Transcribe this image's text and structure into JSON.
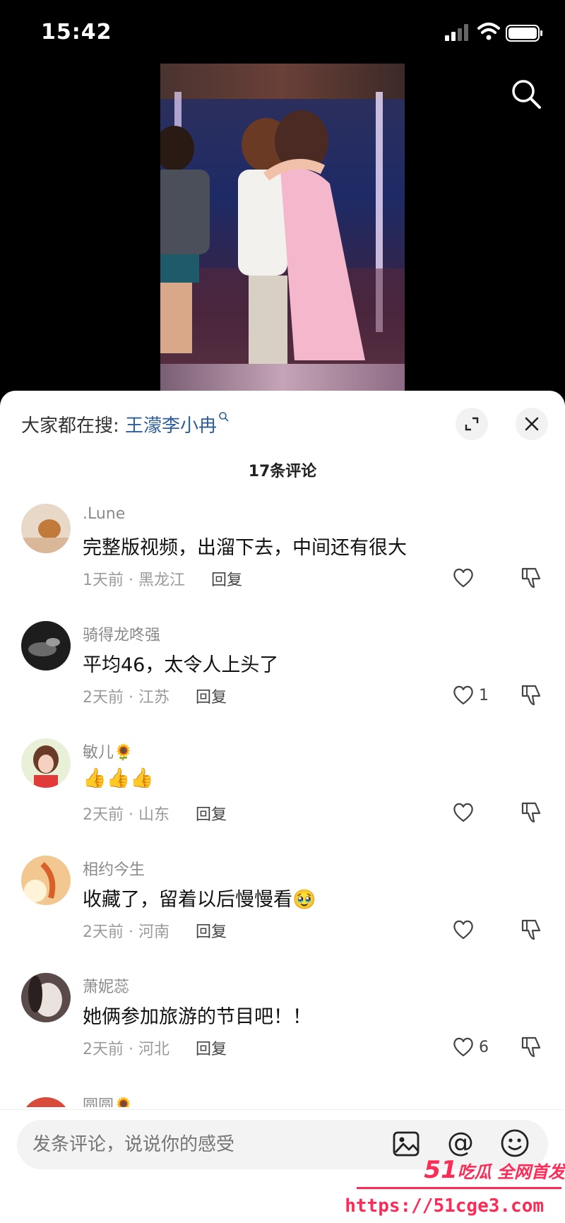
{
  "status_bar": {
    "time": "15:42"
  },
  "sheet": {
    "search_hint_prefix": "大家都在搜:",
    "search_hint_keyword": "王濛李小冉",
    "comment_count_label": "17条评论"
  },
  "comments": [
    {
      "user": ".Lune",
      "text": "完整版视频，出溜下去，中间还有很大",
      "time_location": "1天前 · 黑龙江",
      "reply": "回复",
      "likes": "",
      "avatar_color": "#c9a37a"
    },
    {
      "user": "骑得龙咚强",
      "text": "平均46，太令人上头了",
      "time_location": "2天前 · 江苏",
      "reply": "回复",
      "likes": "1",
      "avatar_color": "#2b2b2b"
    },
    {
      "user": "敏儿",
      "user_badge": "🌻",
      "text": "👍👍👍",
      "time_location": "2天前 · 山东",
      "reply": "回复",
      "likes": "",
      "avatar_color": "#f1c3b8"
    },
    {
      "user": "相约今生",
      "text": "收藏了，留着以后慢慢看🥹",
      "time_location": "2天前 · 河南",
      "reply": "回复",
      "likes": "",
      "avatar_color": "#e8a060"
    },
    {
      "user": "萧妮蕊",
      "text": "她俩参加旅游的节目吧！！",
      "time_location": "2天前 · 河北",
      "reply": "回复",
      "likes": "6",
      "avatar_color": "#6b5b5b"
    }
  ],
  "partial_comment": {
    "user": "圆圆",
    "user_badge": "🌻"
  },
  "input_bar": {
    "placeholder": "发条评论，说说你的感受",
    "at_symbol": "@"
  },
  "watermark": {
    "brand_num": "51",
    "brand_text": "吃瓜 全网首发",
    "url": "https://51cge3.com"
  },
  "colors": {
    "keyword": "#2d5d9b",
    "watermark": "#ff2a55"
  }
}
